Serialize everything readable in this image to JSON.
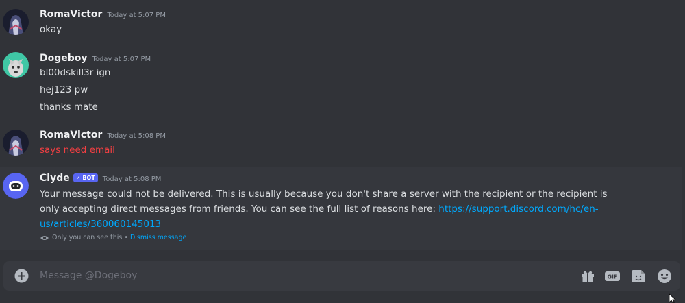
{
  "messages": [
    {
      "author": "RomaVictor",
      "timestamp": "Today at 5:07 PM",
      "lines": [
        "okay"
      ]
    },
    {
      "author": "Dogeboy",
      "timestamp": "Today at 5:07 PM",
      "lines": [
        "bl00dskill3r ign",
        "hej123 pw",
        "thanks mate"
      ]
    },
    {
      "author": "RomaVictor",
      "timestamp": "Today at 5:08 PM",
      "lines": [
        "says need email"
      ]
    }
  ],
  "clyde": {
    "author": "Clyde",
    "badge": "BOT",
    "timestamp": "Today at 5:08 PM",
    "text": "Your message could not be delivered. This is usually because you don't share a server with the recipient or the recipient is only accepting direct messages from friends. You can see the full list of reasons here: ",
    "link": "https://support.discord.com/hc/en-us/articles/360060145013",
    "ephemeral_note": "Only you can see this",
    "separator": "•",
    "dismiss_label": "Dismiss message"
  },
  "composer": {
    "placeholder": "Message @Dogeboy",
    "icons": [
      "plus-icon",
      "gift-icon",
      "gif-icon",
      "sticker-icon",
      "emoji-icon"
    ]
  },
  "colors": {
    "background": "#313338",
    "composer": "#383a40",
    "link": "#00a8fc",
    "red_text": "#f23f42",
    "bot_badge": "#5865f2"
  }
}
